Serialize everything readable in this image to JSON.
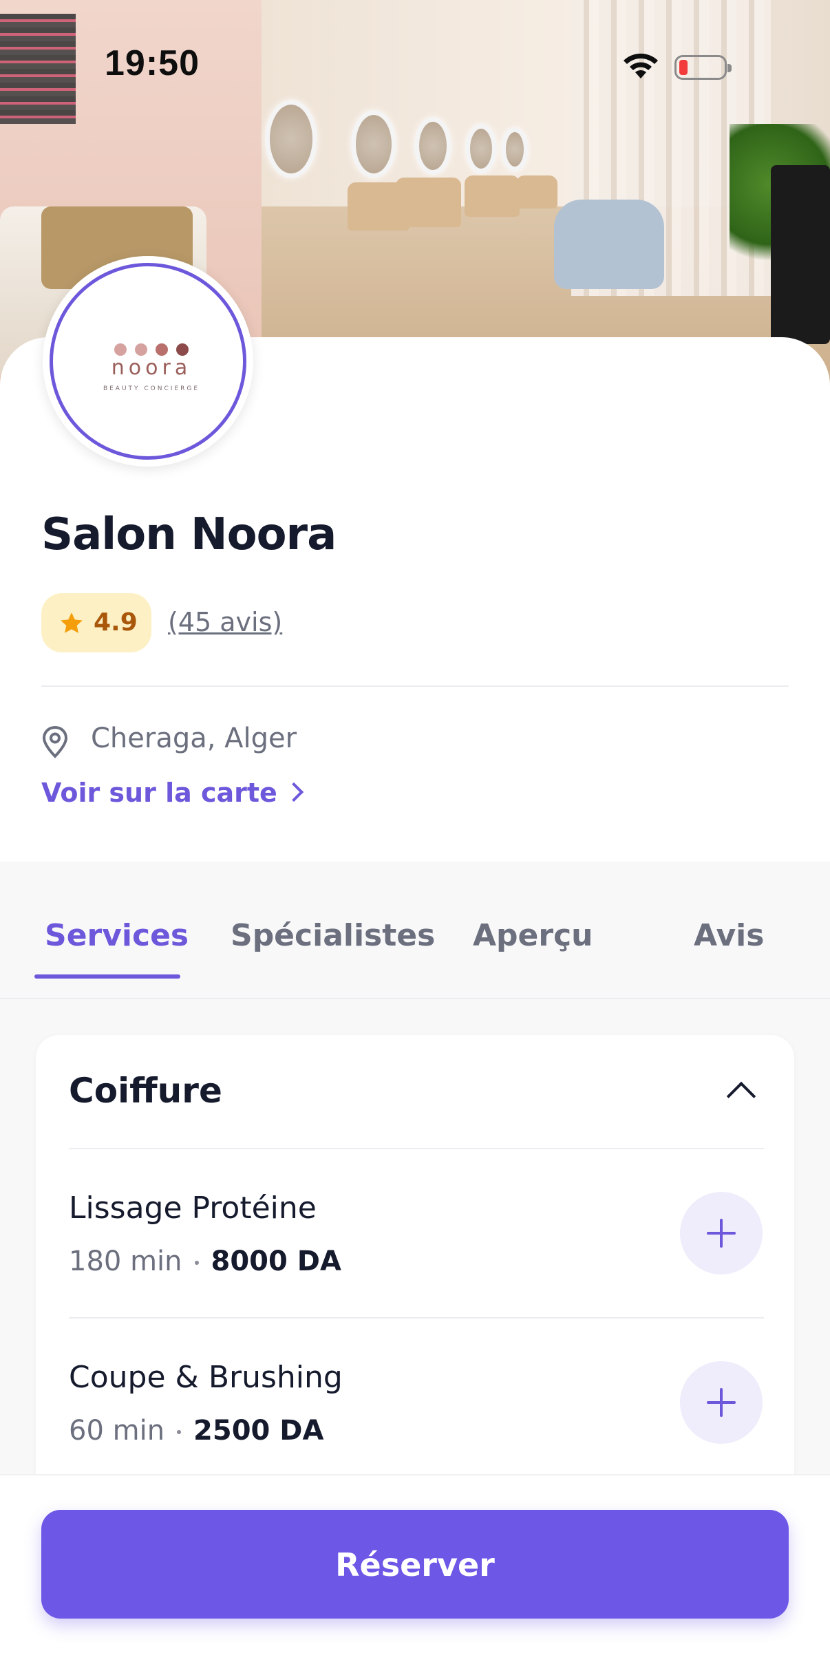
{
  "status_bar": {
    "time": "19:50"
  },
  "salon": {
    "name": "Salon Noora",
    "logo": {
      "word": "noora",
      "tagline": "BEAUTY CONCIERGE"
    },
    "rating": "4.9",
    "reviews_link": "(45 avis)",
    "location": "Cheraga, Alger",
    "map_link": "Voir sur la carte"
  },
  "tabs": [
    {
      "label": "Services",
      "active": true
    },
    {
      "label": "Spécialistes",
      "active": false
    },
    {
      "label": "Aperçu",
      "active": false
    },
    {
      "label": "Avis",
      "active": false
    }
  ],
  "category": {
    "title": "Coiffure",
    "services": [
      {
        "name": "Lissage Protéine",
        "duration": "180 min",
        "price": "8000 DA"
      },
      {
        "name": "Coupe & Brushing",
        "duration": "60 min",
        "price": "2500 DA"
      }
    ]
  },
  "bottom_bar": {
    "cta_label": "Réserver"
  },
  "colors": {
    "accent": "#6d57db",
    "star": "#f59e0b",
    "rating_bg": "#fdf0c4",
    "text": "#151a2d",
    "muted": "#6b6f7e"
  }
}
